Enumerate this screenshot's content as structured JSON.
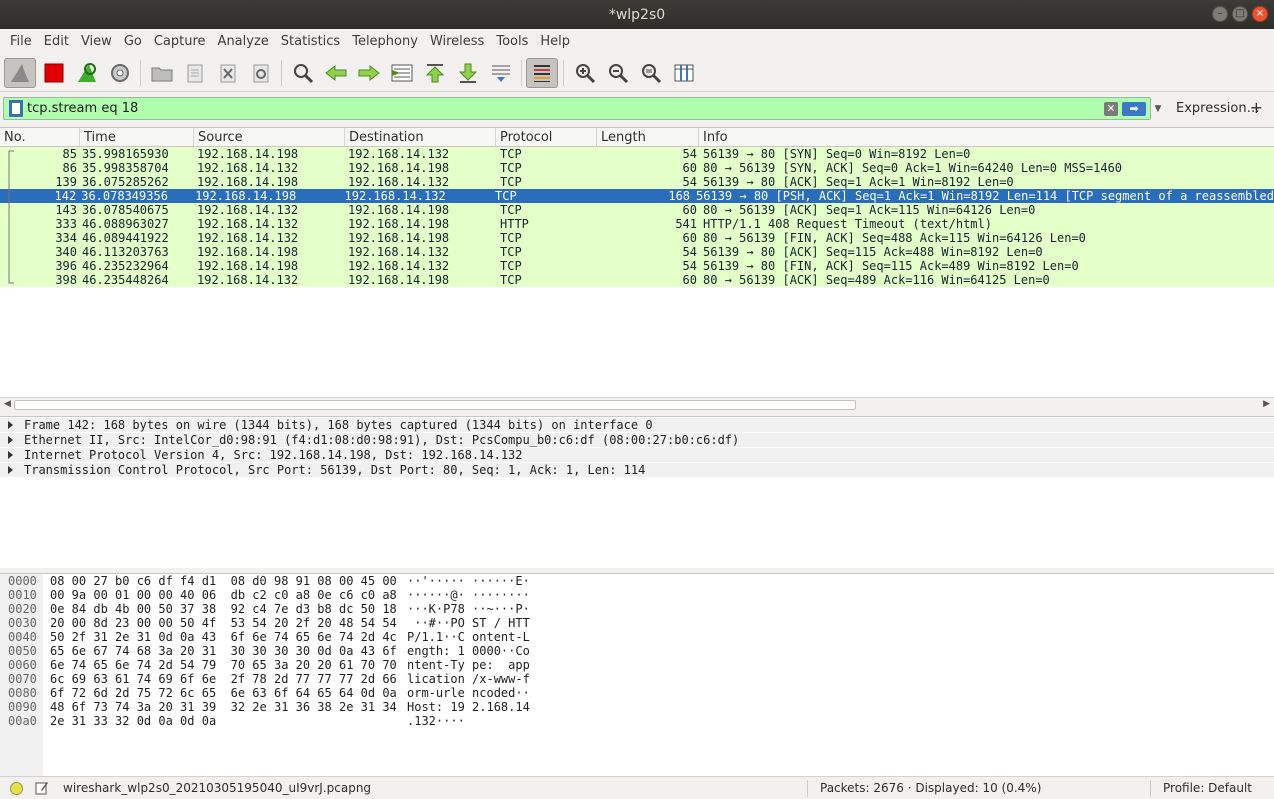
{
  "window": {
    "title": "*wlp2s0"
  },
  "menu": [
    "File",
    "Edit",
    "View",
    "Go",
    "Capture",
    "Analyze",
    "Statistics",
    "Telephony",
    "Wireless",
    "Tools",
    "Help"
  ],
  "filter": {
    "value": "tcp.stream eq 18",
    "expression_label": "Expression…",
    "add_label": "+"
  },
  "columns": [
    "No.",
    "Time",
    "Source",
    "Destination",
    "Protocol",
    "Length",
    "Info"
  ],
  "packets": [
    {
      "no": "85",
      "time": "35.998165930",
      "src": "192.168.14.198",
      "dst": "192.168.14.132",
      "proto": "TCP",
      "len": "54",
      "info": "56139 → 80 [SYN] Seq=0 Win=8192 Len=0"
    },
    {
      "no": "86",
      "time": "35.998358704",
      "src": "192.168.14.132",
      "dst": "192.168.14.198",
      "proto": "TCP",
      "len": "60",
      "info": "80 → 56139 [SYN, ACK] Seq=0 Ack=1 Win=64240 Len=0 MSS=1460"
    },
    {
      "no": "139",
      "time": "36.075285262",
      "src": "192.168.14.198",
      "dst": "192.168.14.132",
      "proto": "TCP",
      "len": "54",
      "info": "56139 → 80 [ACK] Seq=1 Ack=1 Win=8192 Len=0"
    },
    {
      "no": "142",
      "time": "36.078349356",
      "src": "192.168.14.198",
      "dst": "192.168.14.132",
      "proto": "TCP",
      "len": "168",
      "info": "56139 → 80 [PSH, ACK] Seq=1 Ack=1 Win=8192 Len=114 [TCP segment of a reassembled"
    },
    {
      "no": "143",
      "time": "36.078540675",
      "src": "192.168.14.132",
      "dst": "192.168.14.198",
      "proto": "TCP",
      "len": "60",
      "info": "80 → 56139 [ACK] Seq=1 Ack=115 Win=64126 Len=0"
    },
    {
      "no": "333",
      "time": "46.088963027",
      "src": "192.168.14.132",
      "dst": "192.168.14.198",
      "proto": "HTTP",
      "len": "541",
      "info": "HTTP/1.1 408 Request Timeout  (text/html)"
    },
    {
      "no": "334",
      "time": "46.089441922",
      "src": "192.168.14.132",
      "dst": "192.168.14.198",
      "proto": "TCP",
      "len": "60",
      "info": "80 → 56139 [FIN, ACK] Seq=488 Ack=115 Win=64126 Len=0"
    },
    {
      "no": "340",
      "time": "46.113203763",
      "src": "192.168.14.198",
      "dst": "192.168.14.132",
      "proto": "TCP",
      "len": "54",
      "info": "56139 → 80 [ACK] Seq=115 Ack=488 Win=8192 Len=0"
    },
    {
      "no": "396",
      "time": "46.235232964",
      "src": "192.168.14.198",
      "dst": "192.168.14.132",
      "proto": "TCP",
      "len": "54",
      "info": "56139 → 80 [FIN, ACK] Seq=115 Ack=489 Win=8192 Len=0"
    },
    {
      "no": "398",
      "time": "46.235448264",
      "src": "192.168.14.132",
      "dst": "192.168.14.198",
      "proto": "TCP",
      "len": "60",
      "info": "80 → 56139 [ACK] Seq=489 Ack=116 Win=64125 Len=0"
    }
  ],
  "selected_packet": "142",
  "details": [
    "Frame 142: 168 bytes on wire (1344 bits), 168 bytes captured (1344 bits) on interface 0",
    "Ethernet II, Src: IntelCor_d0:98:91 (f4:d1:08:d0:98:91), Dst: PcsCompu_b0:c6:df (08:00:27:b0:c6:df)",
    "Internet Protocol Version 4, Src: 192.168.14.198, Dst: 192.168.14.132",
    "Transmission Control Protocol, Src Port: 56139, Dst Port: 80, Seq: 1, Ack: 1, Len: 114"
  ],
  "bytes": [
    {
      "off": "0000",
      "hex": "08 00 27 b0 c6 df f4 d1  08 d0 98 91 08 00 45 00",
      "asc": "··'····· ······E·"
    },
    {
      "off": "0010",
      "hex": "00 9a 00 01 00 00 40 06  db c2 c0 a8 0e c6 c0 a8",
      "asc": "······@· ········"
    },
    {
      "off": "0020",
      "hex": "0e 84 db 4b 00 50 37 38  92 c4 7e d3 b8 dc 50 18",
      "asc": "···K·P78 ··~···P·"
    },
    {
      "off": "0030",
      "hex": "20 00 8d 23 00 00 50 4f  53 54 20 2f 20 48 54 54",
      "asc": " ··#··PO ST / HTT"
    },
    {
      "off": "0040",
      "hex": "50 2f 31 2e 31 0d 0a 43  6f 6e 74 65 6e 74 2d 4c",
      "asc": "P/1.1··C ontent-L"
    },
    {
      "off": "0050",
      "hex": "65 6e 67 74 68 3a 20 31  30 30 30 30 0d 0a 43 6f",
      "asc": "ength: 1 0000··Co"
    },
    {
      "off": "0060",
      "hex": "6e 74 65 6e 74 2d 54 79  70 65 3a 20 20 61 70 70",
      "asc": "ntent-Ty pe:  app"
    },
    {
      "off": "0070",
      "hex": "6c 69 63 61 74 69 6f 6e  2f 78 2d 77 77 77 2d 66",
      "asc": "lication /x-www-f"
    },
    {
      "off": "0080",
      "hex": "6f 72 6d 2d 75 72 6c 65  6e 63 6f 64 65 64 0d 0a",
      "asc": "orm-urle ncoded··"
    },
    {
      "off": "0090",
      "hex": "48 6f 73 74 3a 20 31 39  32 2e 31 36 38 2e 31 34",
      "asc": "Host: 19 2.168.14"
    },
    {
      "off": "00a0",
      "hex": "2e 31 33 32 0d 0a 0d 0a",
      "asc": ".132····"
    }
  ],
  "status": {
    "file": "wireshark_wlp2s0_20210305195040_uI9vrJ.pcapng",
    "packets": "Packets: 2676 · Displayed: 10 (0.4%)",
    "profile": "Profile: Default"
  },
  "colors": {
    "tcp_row": "#e4ffc7",
    "selected_row": "#2a6ebb",
    "filter_valid": "#afffaf"
  }
}
